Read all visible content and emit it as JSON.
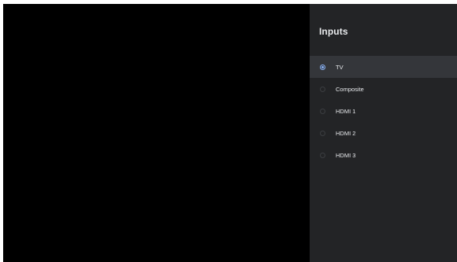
{
  "panel": {
    "title": "Inputs",
    "items": [
      {
        "label": "TV",
        "selected": true
      },
      {
        "label": "Composite",
        "selected": false
      },
      {
        "label": "HDMI 1",
        "selected": false
      },
      {
        "label": "HDMI 2",
        "selected": false
      },
      {
        "label": "HDMI 3",
        "selected": false
      }
    ]
  },
  "colors": {
    "screen": "#000000",
    "panel_background": "#232426",
    "selected_row": "#34363a",
    "accent": "#8ab4f8",
    "text": "#e8eaed"
  },
  "icons": {
    "selected": "radio-selected-icon",
    "unselected": "radio-unselected-icon"
  }
}
